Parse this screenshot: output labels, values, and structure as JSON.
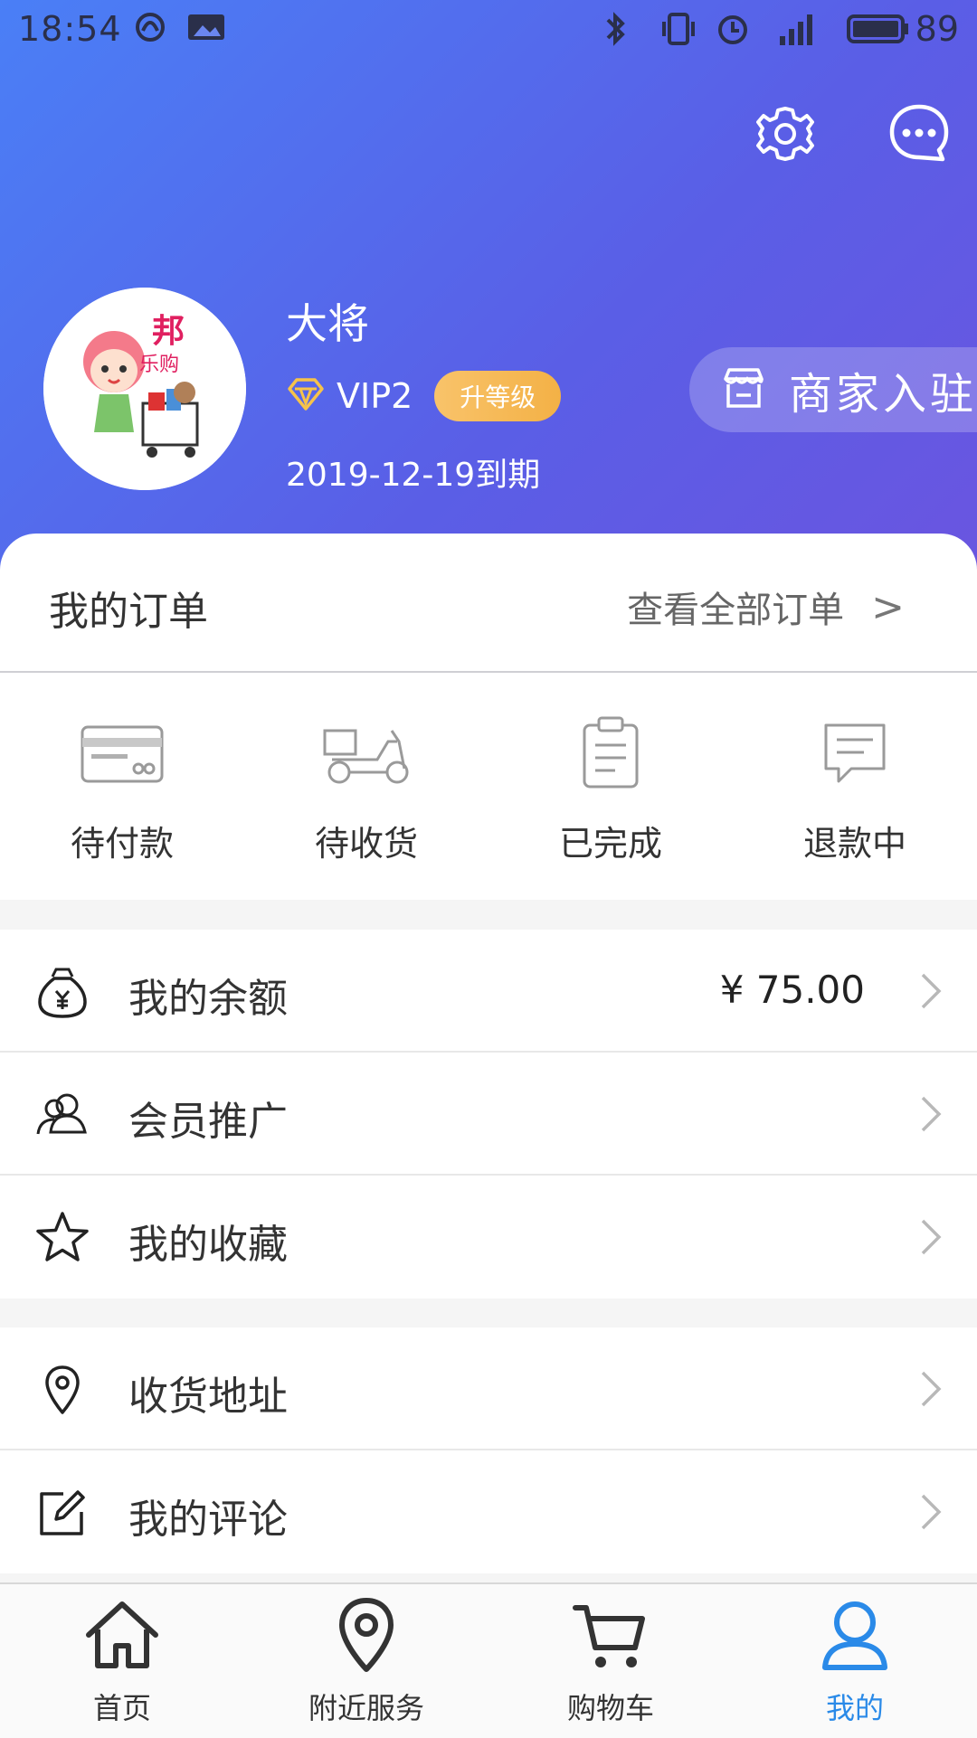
{
  "status_bar": {
    "time": "18:54",
    "battery": "89",
    "icons": [
      "netease-icon",
      "image-icon",
      "bluetooth-icon",
      "vibrate-icon",
      "alarm-icon",
      "signal-4g-icon",
      "battery-icon"
    ]
  },
  "header": {
    "settings_icon": "gear-icon",
    "message_icon": "chat-bubble-icon",
    "user": {
      "name": "大将",
      "vip_level": "VIP2",
      "upgrade_label": "升等级",
      "expiry": "2019-12-19到期"
    },
    "merchant_label": "商家入驻",
    "colors": {
      "gradient_start": "#4a7ff6",
      "gradient_end": "#6a55e0",
      "upgrade_btn": "#f3b146"
    }
  },
  "orders": {
    "title": "我的订单",
    "view_all": "查看全部订单",
    "view_all_arrow": ">",
    "items": [
      {
        "label": "待付款",
        "icon": "card-icon"
      },
      {
        "label": "待收货",
        "icon": "scooter-icon"
      },
      {
        "label": "已完成",
        "icon": "clipboard-icon"
      },
      {
        "label": "退款中",
        "icon": "message-icon"
      }
    ]
  },
  "menu_group_1": [
    {
      "label": "我的余额",
      "value": "¥ 75.00",
      "icon": "money-bag-icon"
    },
    {
      "label": "会员推广",
      "value": "",
      "icon": "users-icon"
    },
    {
      "label": "我的收藏",
      "value": "",
      "icon": "star-icon"
    }
  ],
  "menu_group_2": [
    {
      "label": "收货地址",
      "value": "",
      "icon": "location-pin-icon"
    },
    {
      "label": "我的评论",
      "value": "",
      "icon": "edit-icon"
    }
  ],
  "tabbar": {
    "items": [
      {
        "label": "首页",
        "icon": "home-icon"
      },
      {
        "label": "附近服务",
        "icon": "map-pin-icon"
      },
      {
        "label": "购物车",
        "icon": "cart-icon"
      },
      {
        "label": "我的",
        "icon": "user-icon",
        "active": true
      }
    ],
    "active_color": "#2a8ae8"
  }
}
